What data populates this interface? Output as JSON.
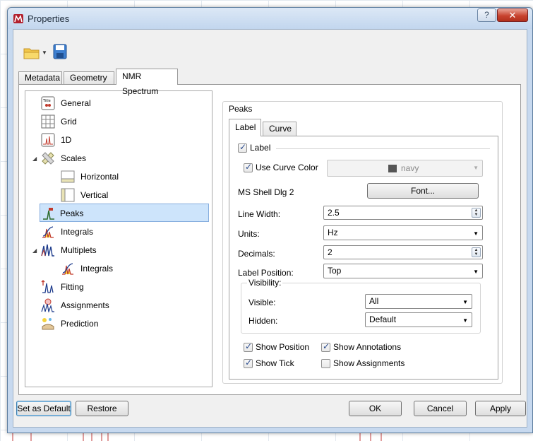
{
  "window": {
    "title": "Properties",
    "help_glyph": "?",
    "close_glyph": "✕"
  },
  "tabs": [
    {
      "label": "Metadata"
    },
    {
      "label": "Geometry"
    },
    {
      "label": "NMR Spectrum"
    }
  ],
  "tree": {
    "items": [
      {
        "label": "General",
        "icon": "title-icon"
      },
      {
        "label": "Grid",
        "icon": "grid-icon"
      },
      {
        "label": "1D",
        "icon": "spectrum-1d-icon"
      },
      {
        "label": "Scales",
        "icon": "scales-icon"
      },
      {
        "label": "Horizontal",
        "icon": "horizontal-scale-icon"
      },
      {
        "label": "Vertical",
        "icon": "vertical-scale-icon"
      },
      {
        "label": "Peaks",
        "icon": "peaks-icon"
      },
      {
        "label": "Integrals",
        "icon": "integrals-icon"
      },
      {
        "label": "Multiplets",
        "icon": "multiplets-icon"
      },
      {
        "label": "Integrals",
        "icon": "integrals-icon"
      },
      {
        "label": "Fitting",
        "icon": "fitting-icon"
      },
      {
        "label": "Assignments",
        "icon": "assignments-icon"
      },
      {
        "label": "Prediction",
        "icon": "prediction-icon"
      }
    ]
  },
  "peaks": {
    "group_title": "Peaks",
    "sub_tabs": [
      {
        "label": "Label"
      },
      {
        "label": "Curve"
      }
    ],
    "label_checkbox": "Label",
    "use_curve_color": "Use Curve Color",
    "color_value": "navy",
    "font_name": "MS Shell Dlg 2",
    "font_button": "Font...",
    "line_width_label": "Line Width:",
    "line_width_value": "2.5",
    "units_label": "Units:",
    "units_value": "Hz",
    "decimals_label": "Decimals:",
    "decimals_value": "2",
    "label_position_label": "Label Position:",
    "label_position_value": "Top",
    "visibility_title": "Visibility:",
    "visible_label": "Visible:",
    "visible_value": "All",
    "hidden_label": "Hidden:",
    "hidden_value": "Default",
    "show_position": "Show Position",
    "show_annotations": "Show Annotations",
    "show_tick": "Show Tick",
    "show_assignments": "Show Assignments"
  },
  "colors": {
    "accent": "#84acdd",
    "navy": "#3a3a3a",
    "selection": "#cde4fb"
  },
  "buttons": {
    "set_default": "Set as Default",
    "restore": "Restore",
    "ok": "OK",
    "cancel": "Cancel",
    "apply": "Apply"
  }
}
